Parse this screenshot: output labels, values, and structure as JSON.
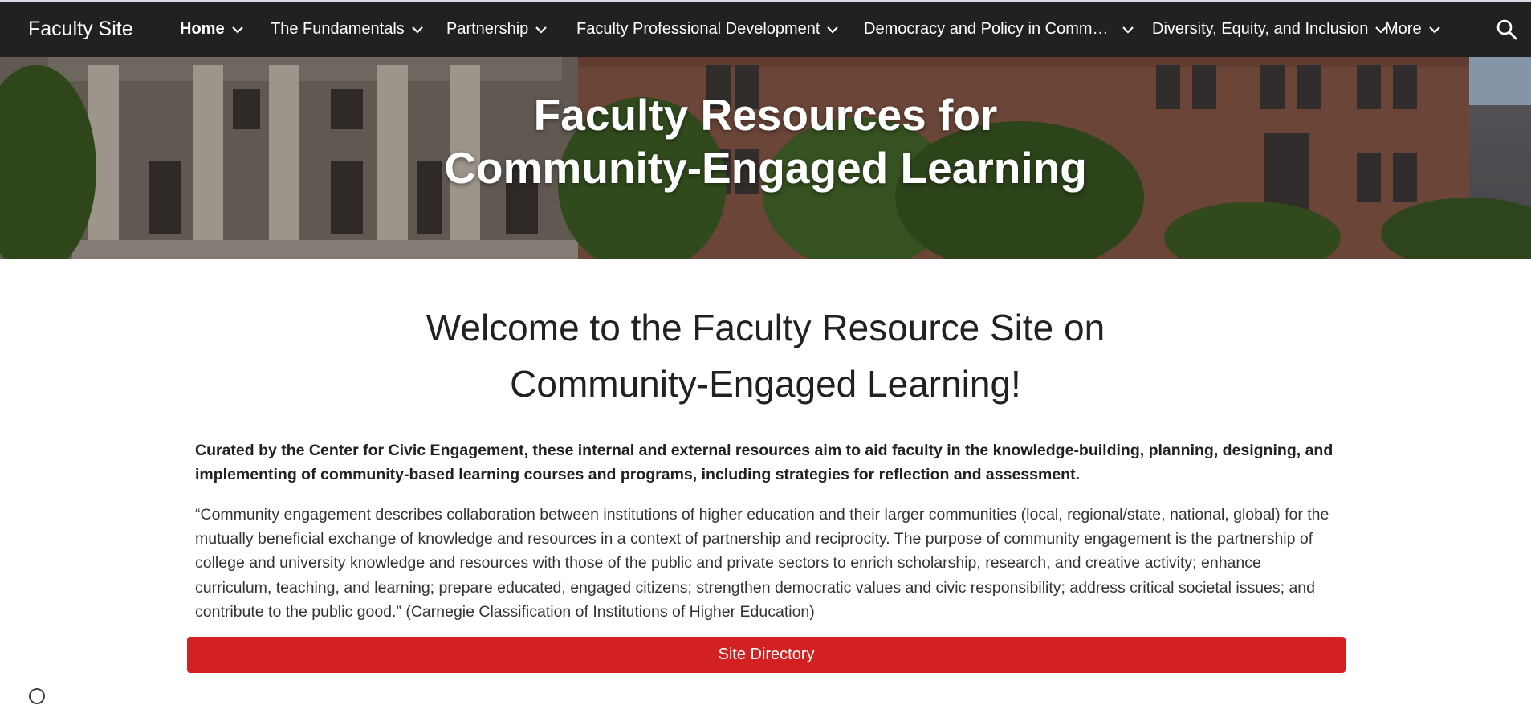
{
  "header": {
    "site_title": "Faculty Site",
    "nav": [
      {
        "label": "Home",
        "active": true
      },
      {
        "label": "The Fundamentals"
      },
      {
        "label": "Partnership"
      },
      {
        "label": "Faculty Professional Development"
      },
      {
        "label": "Democracy and Policy in Comm…"
      },
      {
        "label": "Diversity, Equity, and Inclusion"
      },
      {
        "label": "More"
      }
    ],
    "search_icon": "search-icon",
    "dropdown_icon": "chevron-down-icon"
  },
  "hero": {
    "title_line1": "Faculty Resources for",
    "title_line2": "Community-Engaged Learning"
  },
  "main": {
    "welcome_line1": "Welcome to the Faculty Resource Site on",
    "welcome_line2": "Community-Engaged Learning!",
    "lead": "Curated by the Center for Civic Engagement, these internal and external resources aim to aid faculty in the knowledge-building, planning, designing, and implementing of community-based learning courses and programs, including strategies for reflection and assessment.",
    "quote": "“Community engagement describes collaboration between institutions of higher education and their larger communities (local, regional/state, national, global) for the mutually beneficial exchange of knowledge and resources in a context of partnership and reciprocity. The purpose of community engagement is the partnership of college and university knowledge and resources with those of the public and private sectors to enrich scholarship, research, and creative activity; enhance curriculum, teaching, and learning; prepare educated, engaged citizens; strengthen democratic values and civic responsibility; address critical societal issues; and contribute to the public good.”  (Carnegie Classification of Institutions of Higher Education)",
    "directory_button": "Site Directory"
  },
  "colors": {
    "nav_bg": "#212121",
    "button_red": "#d32020",
    "text": "#212121"
  }
}
